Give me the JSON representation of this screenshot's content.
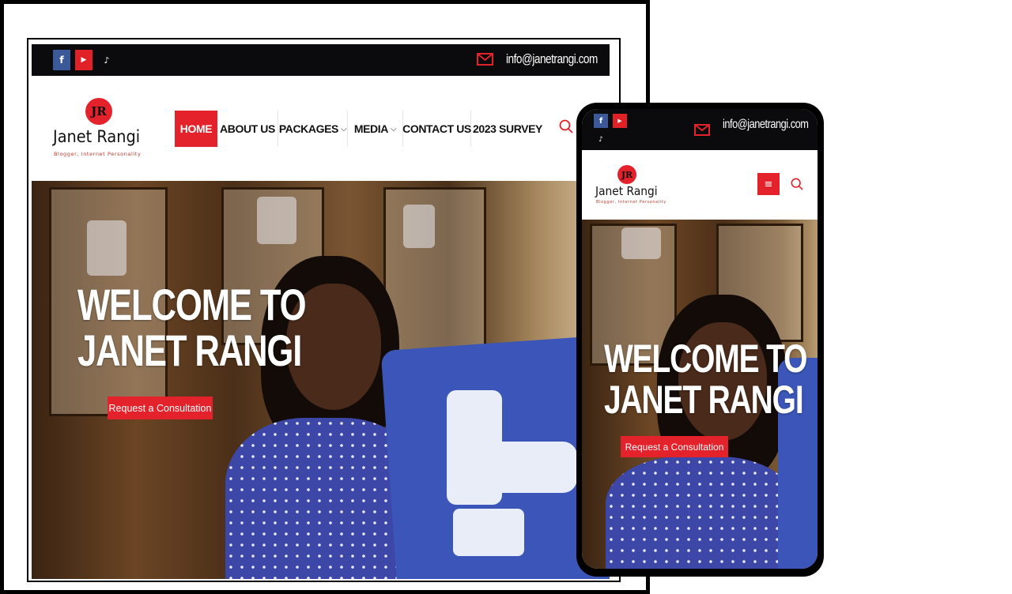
{
  "brand": {
    "name": "Janet Rangi",
    "tagline": "Blogger, Internet Personality",
    "monogram": "JR",
    "accent_color": "#e3222b",
    "topbar_color": "#0b0b0d"
  },
  "topbar": {
    "social": [
      {
        "icon": "facebook-icon",
        "glyph": "f"
      },
      {
        "icon": "youtube-icon",
        "glyph": "▶"
      },
      {
        "icon": "tiktok-icon",
        "glyph": "♪"
      }
    ],
    "email": "info@janetrangi.com"
  },
  "nav": {
    "items": [
      {
        "label": "HOME",
        "active": true
      },
      {
        "label": "ABOUT US"
      },
      {
        "label": "PACKAGES",
        "dropdown": true
      },
      {
        "label": "MEDIA",
        "dropdown": true
      },
      {
        "label": "CONTACT US"
      },
      {
        "label": "2023 SURVEY"
      }
    ],
    "caret": "⌵"
  },
  "hero": {
    "title_line1": "WELCOME TO",
    "title_line2": "JANET RANGI",
    "cta_label": "Request a Consultation"
  },
  "mobile": {
    "menu_glyph": "≡"
  }
}
